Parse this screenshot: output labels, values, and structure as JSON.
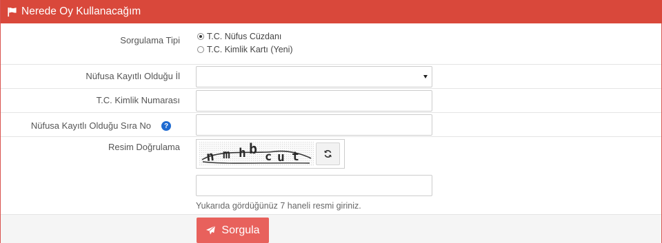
{
  "header": {
    "title": "Nerede Oy Kullanacağım",
    "icon": "flag-icon"
  },
  "form": {
    "query_type": {
      "label": "Sorgulama Tipi",
      "options": [
        {
          "label": "T.C. Nüfus Cüzdanı",
          "checked": true
        },
        {
          "label": "T.C. Kimlik Kartı (Yeni)",
          "checked": false
        }
      ]
    },
    "province": {
      "label": "Nüfusa Kayıtlı Olduğu İl",
      "value": ""
    },
    "tc_number": {
      "label": "T.C. Kimlik Numarası",
      "value": ""
    },
    "sequence_no": {
      "label": "Nüfusa Kayıtlı Olduğu Sıra No",
      "help_icon": "question-circle-icon"
    },
    "captcha": {
      "label": "Resim Doğrulama",
      "refresh_icon": "refresh-icon",
      "value": "",
      "hint": "Yukarıda gördüğünüz 7 haneli resmi giriniz."
    }
  },
  "submit": {
    "label": "Sorgula",
    "icon": "paper-plane-icon"
  },
  "colors": {
    "header": "#d9483b",
    "button": "#e8615c",
    "help": "#1f6bd1"
  }
}
